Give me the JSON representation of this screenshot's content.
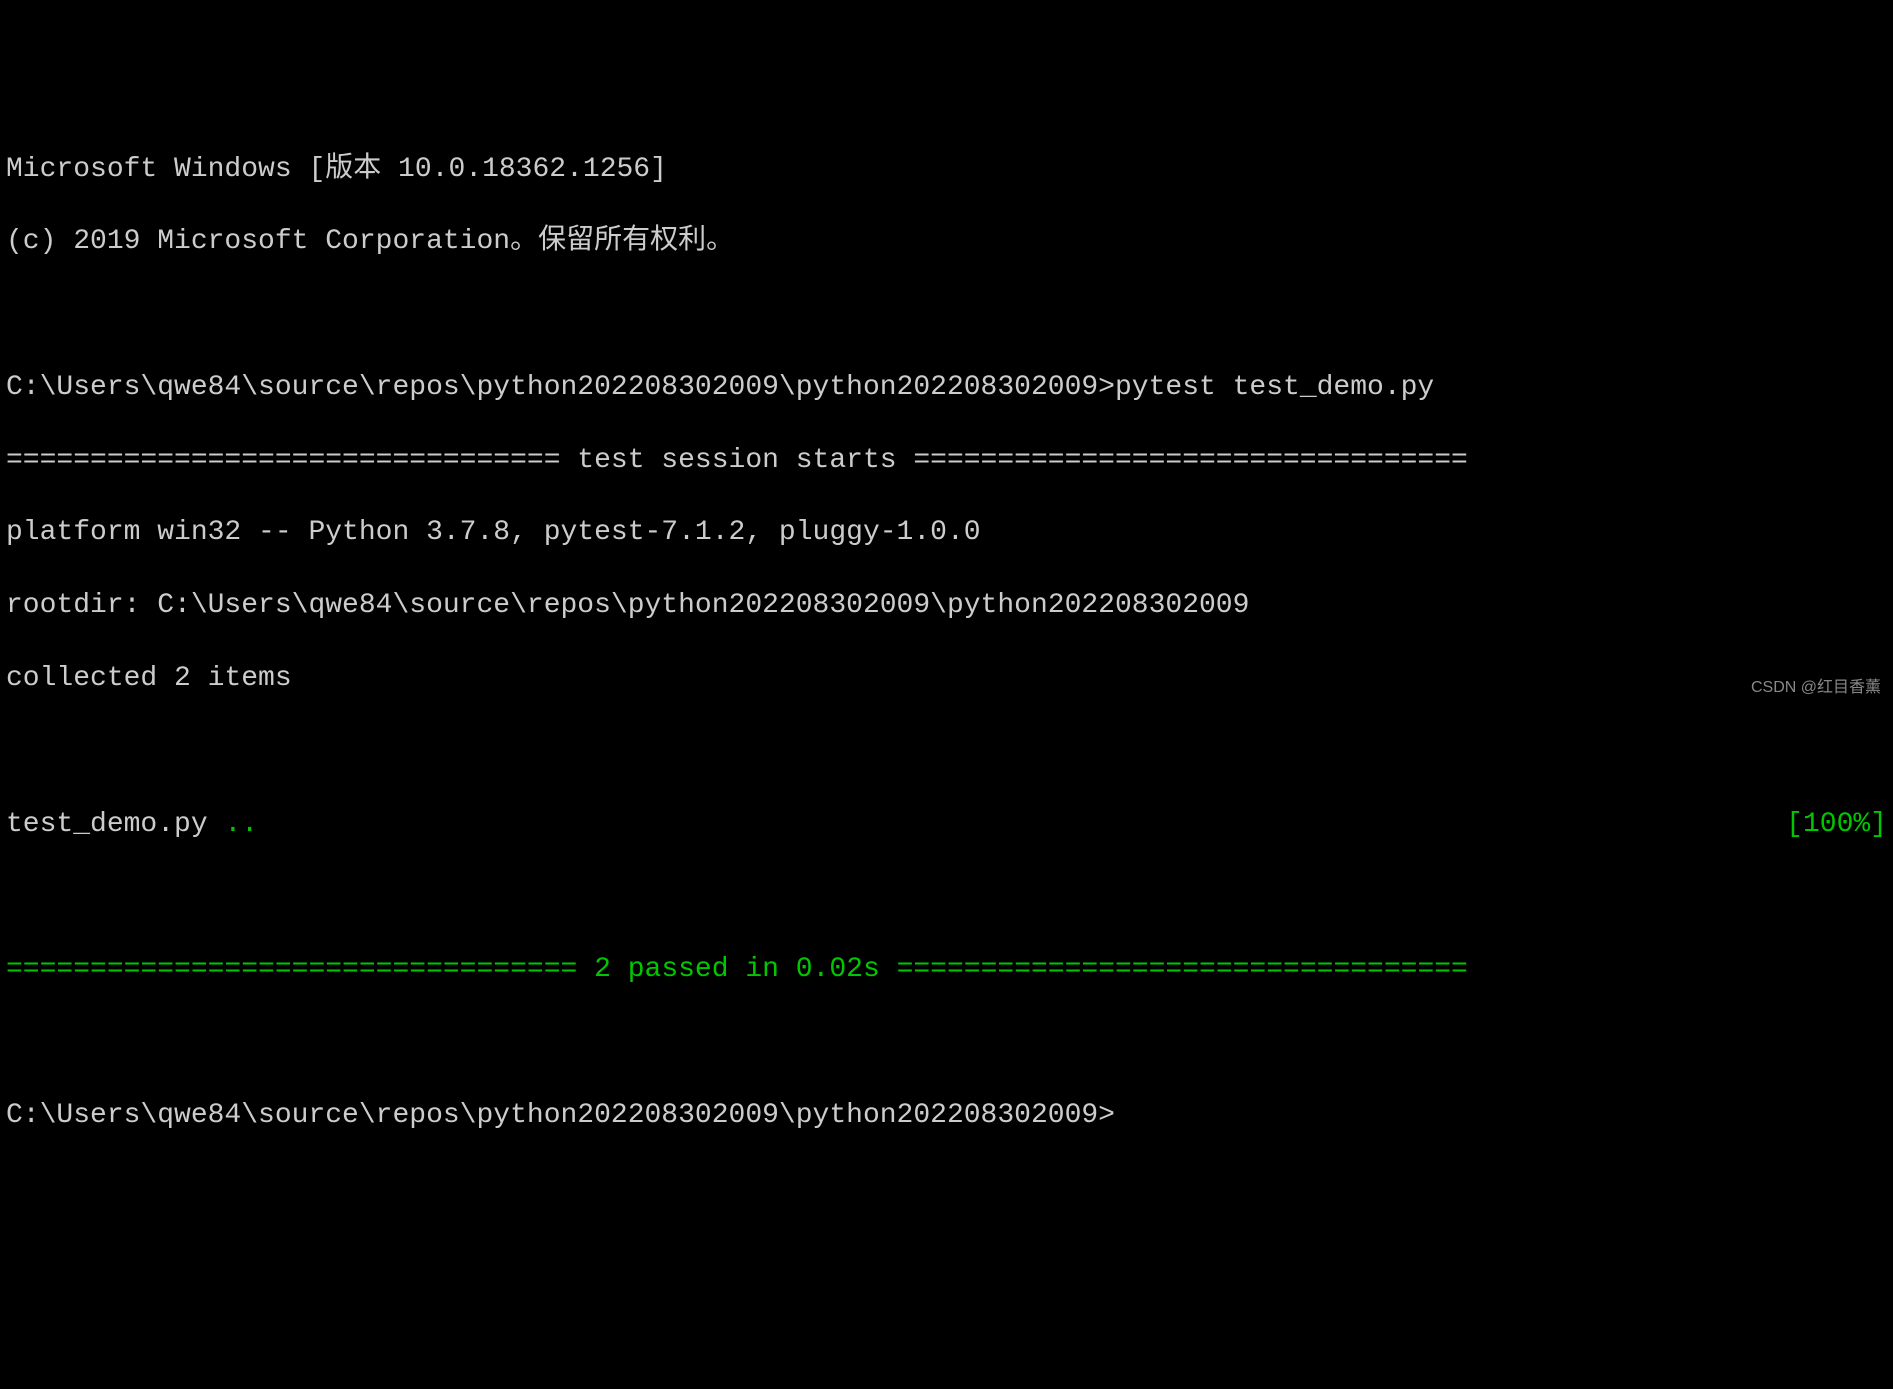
{
  "terminal": {
    "header_line1": "Microsoft Windows [版本 10.0.18362.1256]",
    "header_line2": "(c) 2019 Microsoft Corporation。保留所有权利。",
    "prompt1_path": "C:\\Users\\qwe84\\source\\repos\\python202208302009\\python202208302009>",
    "command": "pytest test_demo.py",
    "session_header": "================================= test session starts =================================",
    "platform_line": "platform win32 -- Python 3.7.8, pytest-7.1.2, pluggy-1.0.0",
    "rootdir_line": "rootdir: C:\\Users\\qwe84\\source\\repos\\python202208302009\\python202208302009",
    "collected_line": "collected 2 items",
    "test_file": "test_demo.py ",
    "test_dots": "..",
    "progress": "[100%]",
    "summary_sep_left": "================================== ",
    "summary_text": "2 passed in 0.02s",
    "summary_sep_right": " ==================================",
    "prompt2_path": "C:\\Users\\qwe84\\source\\repos\\python202208302009\\python202208302009>",
    "watermark": "CSDN @红目香薰"
  }
}
